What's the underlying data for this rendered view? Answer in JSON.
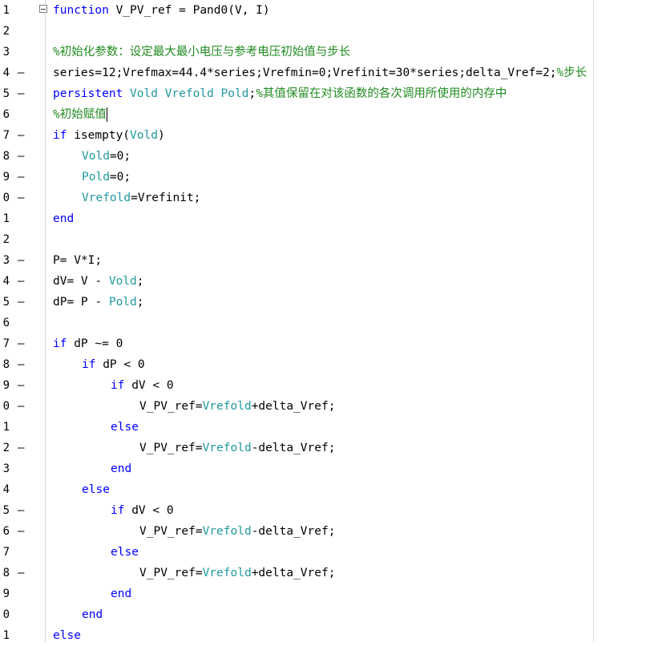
{
  "editor": {
    "line_numbers": [
      "1",
      "2",
      "3",
      "4",
      "5",
      "6",
      "7",
      "8",
      "9",
      "0",
      "1",
      "2",
      "3",
      "4",
      "5",
      "6",
      "7",
      "8",
      "9",
      "0",
      "1",
      "2",
      "3",
      "4",
      "5",
      "6",
      "7",
      "8",
      "9",
      "0",
      "1"
    ],
    "exec_mark": "—",
    "lines": [
      {
        "n": "1",
        "mark": false,
        "indent": 0,
        "tokens": [
          [
            "kw",
            "function"
          ],
          [
            "t",
            " V_PV_ref = Pand0(V, I)"
          ]
        ]
      },
      {
        "n": "2",
        "mark": false,
        "indent": 0,
        "tokens": []
      },
      {
        "n": "3",
        "mark": false,
        "indent": 0,
        "tokens": [
          [
            "cm",
            "%初始化参数：设定最大最小电压与参考电压初始值与步长"
          ]
        ]
      },
      {
        "n": "4",
        "mark": true,
        "indent": 0,
        "tokens": [
          [
            "t",
            "series=12;Vrefmax=44.4*series;Vrefmin=0;Vrefinit=30*series;delta_Vref=2;"
          ],
          [
            "cm",
            "%步长"
          ]
        ]
      },
      {
        "n": "5",
        "mark": true,
        "indent": 0,
        "tokens": [
          [
            "kw",
            "persistent"
          ],
          [
            "t",
            " "
          ],
          [
            "var",
            "Vold Vrefold Pold"
          ],
          [
            "t",
            ";"
          ],
          [
            "cm",
            "%其值保留在对该函数的各次调用所使用的内存中"
          ]
        ]
      },
      {
        "n": "6",
        "mark": false,
        "indent": 0,
        "tokens": [
          [
            "cm",
            "%初始赋值"
          ]
        ],
        "caret": true
      },
      {
        "n": "7",
        "mark": true,
        "indent": 0,
        "tokens": [
          [
            "kw",
            "if"
          ],
          [
            "t",
            " isempty("
          ],
          [
            "var",
            "Vold"
          ],
          [
            "t",
            ")"
          ]
        ]
      },
      {
        "n": "8",
        "mark": true,
        "indent": 1,
        "tokens": [
          [
            "var",
            "Vold"
          ],
          [
            "t",
            "=0;"
          ]
        ]
      },
      {
        "n": "9",
        "mark": true,
        "indent": 1,
        "tokens": [
          [
            "var",
            "Pold"
          ],
          [
            "t",
            "=0;"
          ]
        ]
      },
      {
        "n": "0",
        "mark": true,
        "indent": 1,
        "tokens": [
          [
            "var",
            "Vrefold"
          ],
          [
            "t",
            "=Vrefinit;"
          ]
        ]
      },
      {
        "n": "1",
        "mark": false,
        "indent": 0,
        "tokens": [
          [
            "kw",
            "end"
          ]
        ]
      },
      {
        "n": "2",
        "mark": false,
        "indent": 0,
        "tokens": []
      },
      {
        "n": "3",
        "mark": true,
        "indent": 0,
        "tokens": [
          [
            "t",
            "P= V*I;"
          ]
        ]
      },
      {
        "n": "4",
        "mark": true,
        "indent": 0,
        "tokens": [
          [
            "t",
            "dV= V - "
          ],
          [
            "var",
            "Vold"
          ],
          [
            "t",
            ";"
          ]
        ]
      },
      {
        "n": "5",
        "mark": true,
        "indent": 0,
        "tokens": [
          [
            "t",
            "dP= P - "
          ],
          [
            "var",
            "Pold"
          ],
          [
            "t",
            ";"
          ]
        ]
      },
      {
        "n": "6",
        "mark": false,
        "indent": 0,
        "tokens": []
      },
      {
        "n": "7",
        "mark": true,
        "indent": 0,
        "tokens": [
          [
            "kw",
            "if"
          ],
          [
            "t",
            " dP ~= 0"
          ]
        ]
      },
      {
        "n": "8",
        "mark": true,
        "indent": 1,
        "tokens": [
          [
            "kw",
            "if"
          ],
          [
            "t",
            " dP < 0"
          ]
        ]
      },
      {
        "n": "9",
        "mark": true,
        "indent": 2,
        "tokens": [
          [
            "kw",
            "if"
          ],
          [
            "t",
            " dV < 0"
          ]
        ]
      },
      {
        "n": "0",
        "mark": true,
        "indent": 3,
        "tokens": [
          [
            "t",
            "V_PV_ref="
          ],
          [
            "var",
            "Vrefold"
          ],
          [
            "t",
            "+delta_Vref;"
          ]
        ]
      },
      {
        "n": "1",
        "mark": false,
        "indent": 2,
        "tokens": [
          [
            "kw",
            "else"
          ]
        ]
      },
      {
        "n": "2",
        "mark": true,
        "indent": 3,
        "tokens": [
          [
            "t",
            "V_PV_ref="
          ],
          [
            "var",
            "Vrefold"
          ],
          [
            "t",
            "-delta_Vref;"
          ]
        ]
      },
      {
        "n": "3",
        "mark": false,
        "indent": 2,
        "tokens": [
          [
            "kw",
            "end"
          ]
        ]
      },
      {
        "n": "4",
        "mark": false,
        "indent": 1,
        "tokens": [
          [
            "kw",
            "else"
          ]
        ]
      },
      {
        "n": "5",
        "mark": true,
        "indent": 2,
        "tokens": [
          [
            "kw",
            "if"
          ],
          [
            "t",
            " dV < 0"
          ]
        ]
      },
      {
        "n": "6",
        "mark": true,
        "indent": 3,
        "tokens": [
          [
            "t",
            "V_PV_ref="
          ],
          [
            "var",
            "Vrefold"
          ],
          [
            "t",
            "-delta_Vref;"
          ]
        ]
      },
      {
        "n": "7",
        "mark": false,
        "indent": 2,
        "tokens": [
          [
            "kw",
            "else"
          ]
        ]
      },
      {
        "n": "8",
        "mark": true,
        "indent": 3,
        "tokens": [
          [
            "t",
            "V_PV_ref="
          ],
          [
            "var",
            "Vrefold"
          ],
          [
            "t",
            "+delta_Vref;"
          ]
        ]
      },
      {
        "n": "9",
        "mark": false,
        "indent": 2,
        "tokens": [
          [
            "kw",
            "end"
          ]
        ]
      },
      {
        "n": "0",
        "mark": false,
        "indent": 1,
        "tokens": [
          [
            "kw",
            "end"
          ]
        ]
      },
      {
        "n": "1",
        "mark": false,
        "indent": 0,
        "tokens": [
          [
            "kw",
            "else"
          ]
        ]
      }
    ]
  },
  "colors": {
    "keyword": "#0000ff",
    "comment": "#228b22",
    "persistent_var": "#20999d",
    "text": "#000000"
  },
  "icons": {
    "fold": "fold-collapse-icon"
  }
}
